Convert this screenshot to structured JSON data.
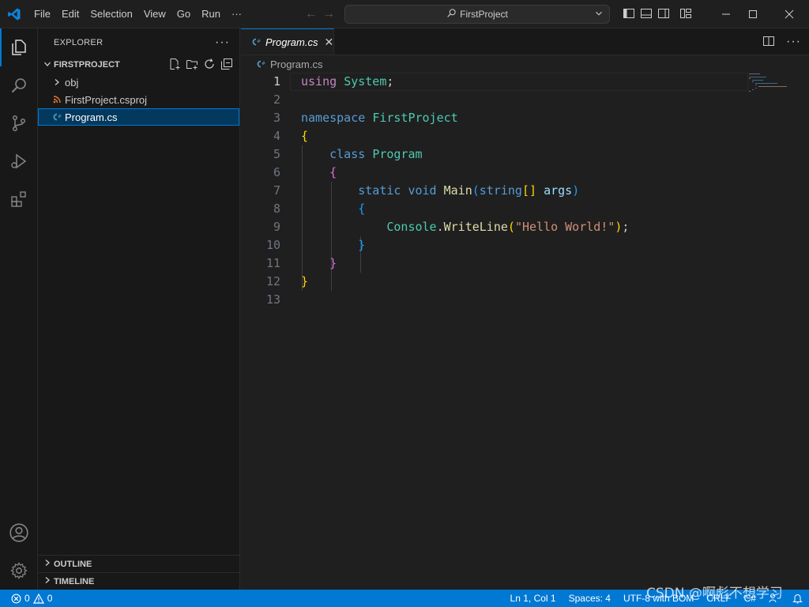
{
  "menu": [
    "File",
    "Edit",
    "Selection",
    "View",
    "Go",
    "Run",
    "···"
  ],
  "command_center": {
    "label": "FirstProject"
  },
  "explorer": {
    "title": "EXPLORER",
    "more": "···",
    "folder": "FIRSTPROJECT",
    "items": [
      {
        "label": "obj",
        "kind": "folder"
      },
      {
        "label": "FirstProject.csproj",
        "kind": "rss-file"
      },
      {
        "label": "Program.cs",
        "kind": "csharp-file"
      }
    ],
    "outline": "OUTLINE",
    "timeline": "TIMELINE"
  },
  "editor": {
    "tab": {
      "label": "Program.cs",
      "close": "✕"
    },
    "breadcrumb": "Program.cs",
    "current_line": 1
  },
  "code_lines": [
    {
      "n": "1",
      "tokens": [
        [
          "kw2",
          "using"
        ],
        [
          "pn",
          " "
        ],
        [
          "ty",
          "System"
        ],
        [
          "pn",
          ";"
        ]
      ]
    },
    {
      "n": "2",
      "tokens": []
    },
    {
      "n": "3",
      "tokens": [
        [
          "kw",
          "namespace"
        ],
        [
          "pn",
          " "
        ],
        [
          "ty",
          "FirstProject"
        ]
      ]
    },
    {
      "n": "4",
      "tokens": [
        [
          "br1",
          "{"
        ]
      ]
    },
    {
      "n": "5",
      "tokens": [
        [
          "pn",
          "    "
        ],
        [
          "kw",
          "class"
        ],
        [
          "pn",
          " "
        ],
        [
          "ty",
          "Program"
        ]
      ]
    },
    {
      "n": "6",
      "tokens": [
        [
          "pn",
          "    "
        ],
        [
          "br2",
          "{"
        ]
      ]
    },
    {
      "n": "7",
      "tokens": [
        [
          "pn",
          "        "
        ],
        [
          "kw",
          "static"
        ],
        [
          "pn",
          " "
        ],
        [
          "kw",
          "void"
        ],
        [
          "pn",
          " "
        ],
        [
          "fn",
          "Main"
        ],
        [
          "br3",
          "("
        ],
        [
          "kw",
          "string"
        ],
        [
          "br1",
          "[]"
        ],
        [
          "pn",
          " "
        ],
        [
          "var",
          "args"
        ],
        [
          "br3",
          ")"
        ]
      ]
    },
    {
      "n": "8",
      "tokens": [
        [
          "pn",
          "        "
        ],
        [
          "br3",
          "{"
        ]
      ]
    },
    {
      "n": "9",
      "tokens": [
        [
          "pn",
          "            "
        ],
        [
          "ty",
          "Console"
        ],
        [
          "pn",
          "."
        ],
        [
          "fn",
          "WriteLine"
        ],
        [
          "br1",
          "("
        ],
        [
          "str",
          "\"Hello World!\""
        ],
        [
          "br1",
          ")"
        ],
        [
          "pn",
          ";"
        ]
      ]
    },
    {
      "n": "10",
      "tokens": [
        [
          "pn",
          "        "
        ],
        [
          "br3",
          "}"
        ]
      ]
    },
    {
      "n": "11",
      "tokens": [
        [
          "pn",
          "    "
        ],
        [
          "br2",
          "}"
        ]
      ]
    },
    {
      "n": "12",
      "tokens": [
        [
          "br1",
          "}"
        ]
      ]
    },
    {
      "n": "13",
      "tokens": []
    }
  ],
  "status": {
    "errors": "0",
    "warnings": "0",
    "position": "Ln 1, Col 1",
    "spaces": "Spaces: 4",
    "encoding": "UTF-8 with BOM",
    "eol": "CRLF",
    "language": "C#"
  },
  "watermark": "CSDN @啊彪不想学习",
  "colors": {
    "accent": "#0078d4",
    "status_bar": "#0078d4",
    "sidebar_bg": "#181818",
    "editor_bg": "#1f1f1f"
  }
}
